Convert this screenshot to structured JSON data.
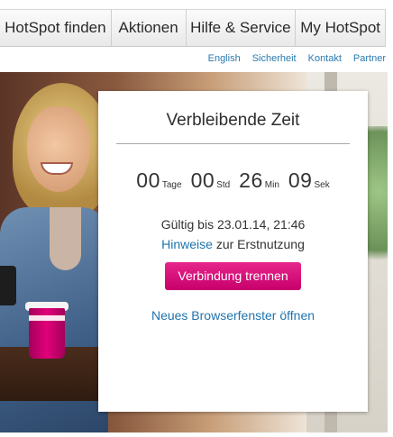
{
  "nav": {
    "items": [
      {
        "label": "HotSpot finden"
      },
      {
        "label": "Aktionen"
      },
      {
        "label": "Hilfe & Service"
      },
      {
        "label": "My HotSpot"
      }
    ]
  },
  "utility_links": [
    "English",
    "Sicherheit",
    "Kontakt",
    "Partner"
  ],
  "card": {
    "title": "Verbleibende Zeit",
    "timer": {
      "days": "00",
      "days_label": "Tage",
      "hours": "00",
      "hours_label": "Std",
      "minutes": "26",
      "minutes_label": "Min",
      "seconds": "09",
      "seconds_label": "Sek"
    },
    "valid_until": "Gültig bis 23.01.14, 21:46",
    "hint_link": "Hinweise",
    "hint_text": " zur Erstnutzung",
    "disconnect_label": "Verbindung trennen",
    "new_window_label": "Neues Browserfenster öffnen"
  },
  "colors": {
    "accent_magenta": "#e2007a",
    "link_blue": "#1f74ae"
  }
}
